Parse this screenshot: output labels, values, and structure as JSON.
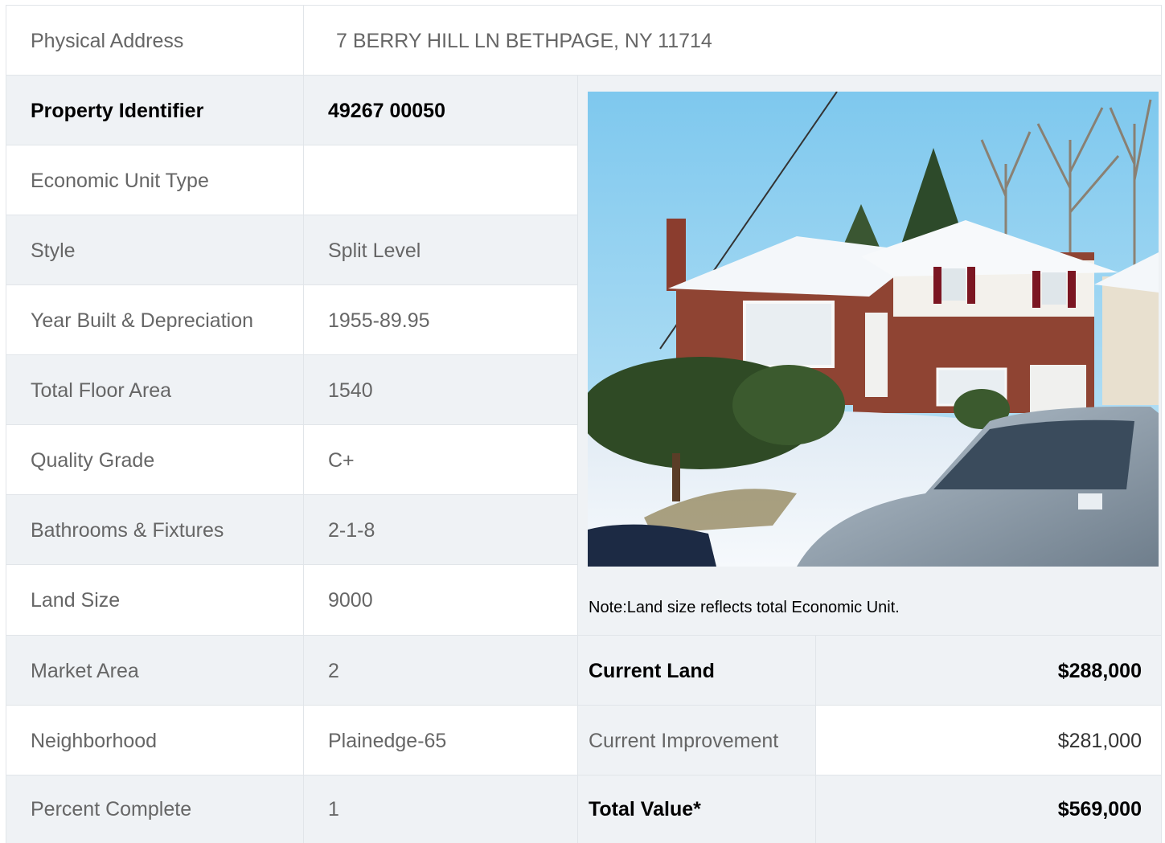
{
  "address": {
    "label": "Physical Address",
    "value": "7  BERRY HILL LN  BETHPAGE, NY  11714"
  },
  "rows": [
    {
      "label": "Property Identifier",
      "value": "49267  00050",
      "bold": true
    },
    {
      "label": "Economic Unit Type",
      "value": ""
    },
    {
      "label": "Style",
      "value": "Split Level"
    },
    {
      "label": "Year Built & Depreciation",
      "value": "1955-89.95"
    },
    {
      "label": "Total Floor Area",
      "value": "1540"
    },
    {
      "label": "Quality Grade",
      "value": "C+"
    },
    {
      "label": "Bathrooms & Fixtures",
      "value": "2-1-8"
    },
    {
      "label": "Land Size",
      "value": "9000"
    },
    {
      "label": "Market Area",
      "value": "2"
    },
    {
      "label": "Neighborhood",
      "value": "Plainedge-65"
    },
    {
      "label": "Percent Complete",
      "value": "1"
    }
  ],
  "note": "Note:Land size reflects total Economic Unit.",
  "values": [
    {
      "label": "Current Land",
      "value": "$288,000",
      "bold": true
    },
    {
      "label": "Current Improvement",
      "value": "$281,000",
      "bold": false
    },
    {
      "label": "Total Value*",
      "value": "$569,000",
      "bold": true
    }
  ],
  "colors": {
    "row_shade": "#eff2f5",
    "border": "#e1e5e9",
    "muted_text": "#666666",
    "bold_text": "#000000"
  }
}
